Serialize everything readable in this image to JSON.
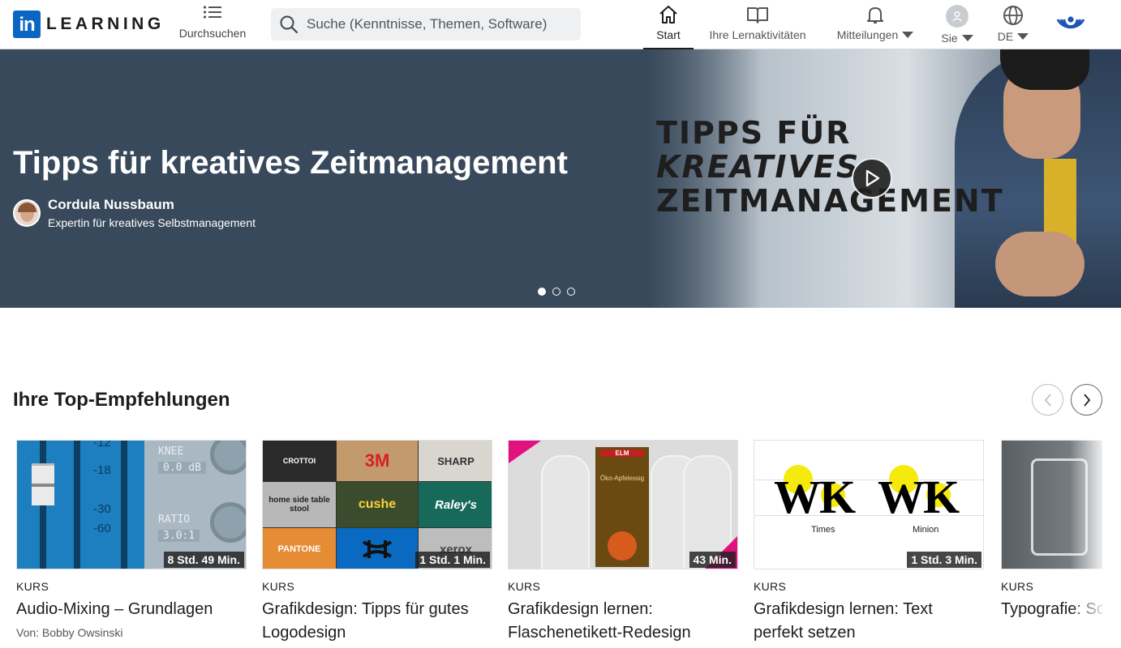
{
  "header": {
    "logo_in": "in",
    "logo_text": "LEARNING",
    "browse_label": "Durchsuchen",
    "search_placeholder": "Suche (Kenntnisse, Themen, Software)",
    "nav": {
      "start": "Start",
      "activities": "Ihre Lernaktivitäten",
      "notifications": "Mitteilungen",
      "me": "Sie",
      "language": "DE"
    }
  },
  "hero": {
    "title": "Tipps für kreatives Zeitmanagement",
    "author_name": "Cordula Nussbaum",
    "author_role": "Expertin für kreatives Selbstmanagement",
    "art_line1": "TIPPS FÜR",
    "art_line2": "KREATIVES",
    "art_line3": "ZEITMANAGEMENT",
    "slides_total": 3,
    "active_slide": 1
  },
  "recommendations": {
    "title": "Ihre Top-Empfehlungen",
    "cards": [
      {
        "kind": "KURS",
        "title": "Audio-Mixing – Grundlagen",
        "author": "Von: Bobby Owsinski",
        "duration": "8 Std. 49 Min.",
        "art": {
          "knee": "KNEE",
          "knee_val": "0.0 dB",
          "ratio": "RATIO",
          "ratio_val": "3.0:1",
          "m18": "-18",
          "m30": "-30",
          "m60": "-60",
          "m12": "-12"
        }
      },
      {
        "kind": "KURS",
        "title": "Grafikdesign: Tipps für gutes Logodesign",
        "author": "",
        "duration": "1 Std. 1 Min.",
        "art": {
          "l1": "CROTTOI",
          "l2": "3M",
          "l3": "SHARP",
          "l4": "home side table stool",
          "l5": "cushe",
          "l6": "Raley's",
          "l7": "PANTONE",
          "l8": "xerox"
        }
      },
      {
        "kind": "KURS",
        "title": "Grafikdesign lernen: Flaschenetikett-Redesign",
        "author": "",
        "duration": "43 Min.",
        "art": {
          "brand": "ELM",
          "product": "Öko-Apfelessig"
        }
      },
      {
        "kind": "KURS",
        "title": "Grafikdesign lernen: Text perfekt setzen",
        "author": "",
        "duration": "1 Std. 3 Min.",
        "art": {
          "glyphs": "WK",
          "font1": "Times",
          "font2": "Minion"
        }
      },
      {
        "kind": "KURS",
        "title": "Typografie: Schrift entwickeln",
        "author": "",
        "duration": "",
        "art": {}
      }
    ]
  }
}
